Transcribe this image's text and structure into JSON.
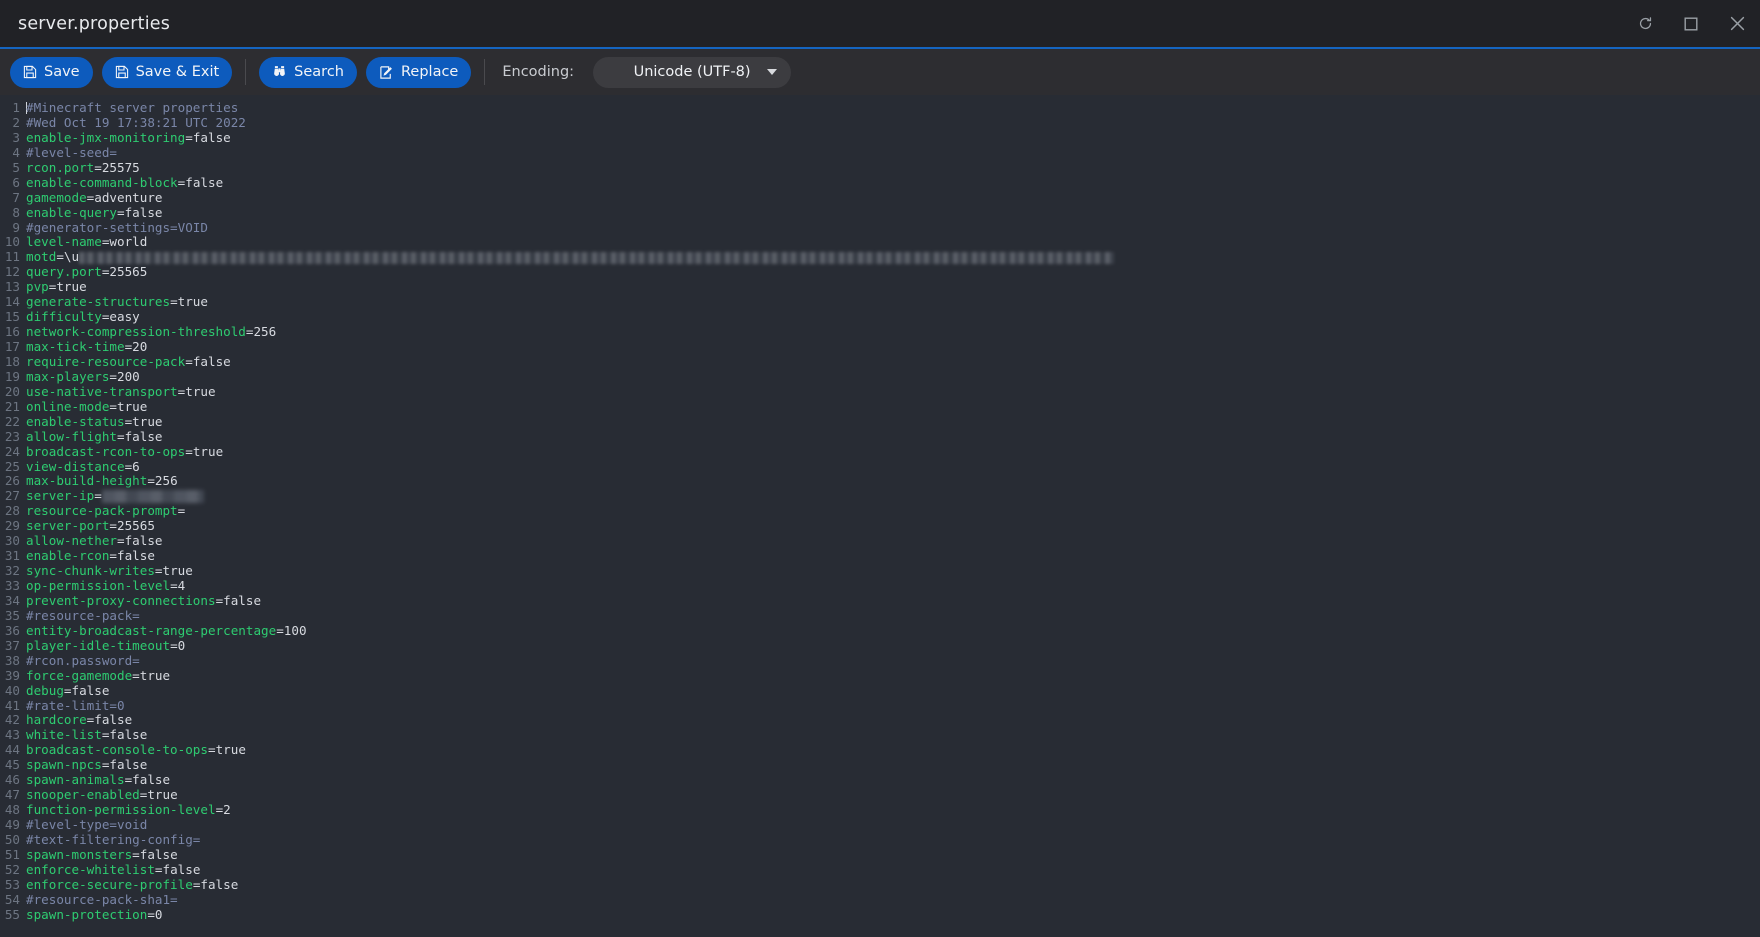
{
  "window": {
    "title": "server.properties",
    "controls": [
      {
        "name": "reload-icon",
        "label": "Reload"
      },
      {
        "name": "maximize-icon",
        "label": "Maximize"
      },
      {
        "name": "close-icon",
        "label": "Close"
      }
    ]
  },
  "toolbar": {
    "save_label": "Save",
    "save_exit_label": "Save & Exit",
    "search_label": "Search",
    "replace_label": "Replace",
    "encoding_label": "Encoding:",
    "encoding_value": "Unicode (UTF-8)",
    "accent_color": "#0d5bbd",
    "bar_color": "#2d2d31"
  },
  "editor": {
    "background": "#282c34",
    "key_color": "#2ecc71",
    "value_color": "#d7dae0",
    "comment_color": "#7a86a8",
    "gutter_color": "#6d7582",
    "caret_line": 1,
    "lines": [
      {
        "n": 1,
        "type": "comment",
        "text": "#Minecraft server properties",
        "caret": true
      },
      {
        "n": 2,
        "type": "comment",
        "text": "#Wed Oct 19 17:38:21 UTC 2022"
      },
      {
        "n": 3,
        "type": "prop",
        "key": "enable-jmx-monitoring",
        "value": "false"
      },
      {
        "n": 4,
        "type": "comment",
        "text": "#level-seed="
      },
      {
        "n": 5,
        "type": "prop",
        "key": "rcon.port",
        "value": "25575"
      },
      {
        "n": 6,
        "type": "prop",
        "key": "enable-command-block",
        "value": "false"
      },
      {
        "n": 7,
        "type": "prop",
        "key": "gamemode",
        "value": "adventure"
      },
      {
        "n": 8,
        "type": "prop",
        "key": "enable-query",
        "value": "false"
      },
      {
        "n": 9,
        "type": "comment",
        "text": "#generator-settings=VOID"
      },
      {
        "n": 10,
        "type": "prop",
        "key": "level-name",
        "value": "world"
      },
      {
        "n": 11,
        "type": "prop",
        "key": "motd",
        "value": "\\u",
        "redacted": true,
        "redact_width": 1035
      },
      {
        "n": 12,
        "type": "prop",
        "key": "query.port",
        "value": "25565"
      },
      {
        "n": 13,
        "type": "prop",
        "key": "pvp",
        "value": "true"
      },
      {
        "n": 14,
        "type": "prop",
        "key": "generate-structures",
        "value": "true"
      },
      {
        "n": 15,
        "type": "prop",
        "key": "difficulty",
        "value": "easy"
      },
      {
        "n": 16,
        "type": "prop",
        "key": "network-compression-threshold",
        "value": "256"
      },
      {
        "n": 17,
        "type": "prop",
        "key": "max-tick-time",
        "value": "20"
      },
      {
        "n": 18,
        "type": "prop",
        "key": "require-resource-pack",
        "value": "false"
      },
      {
        "n": 19,
        "type": "prop",
        "key": "max-players",
        "value": "200"
      },
      {
        "n": 20,
        "type": "prop",
        "key": "use-native-transport",
        "value": "true"
      },
      {
        "n": 21,
        "type": "prop",
        "key": "online-mode",
        "value": "true"
      },
      {
        "n": 22,
        "type": "prop",
        "key": "enable-status",
        "value": "true"
      },
      {
        "n": 23,
        "type": "prop",
        "key": "allow-flight",
        "value": "false"
      },
      {
        "n": 24,
        "type": "prop",
        "key": "broadcast-rcon-to-ops",
        "value": "true"
      },
      {
        "n": 25,
        "type": "prop",
        "key": "view-distance",
        "value": "6"
      },
      {
        "n": 26,
        "type": "prop",
        "key": "max-build-height",
        "value": "256"
      },
      {
        "n": 27,
        "type": "prop",
        "key": "server-ip",
        "value": "",
        "redacted_ip": true,
        "redact_width": 102
      },
      {
        "n": 28,
        "type": "prop",
        "key": "resource-pack-prompt",
        "value": ""
      },
      {
        "n": 29,
        "type": "prop",
        "key": "server-port",
        "value": "25565"
      },
      {
        "n": 30,
        "type": "prop",
        "key": "allow-nether",
        "value": "false"
      },
      {
        "n": 31,
        "type": "prop",
        "key": "enable-rcon",
        "value": "false"
      },
      {
        "n": 32,
        "type": "prop",
        "key": "sync-chunk-writes",
        "value": "true"
      },
      {
        "n": 33,
        "type": "prop",
        "key": "op-permission-level",
        "value": "4"
      },
      {
        "n": 34,
        "type": "prop",
        "key": "prevent-proxy-connections",
        "value": "false"
      },
      {
        "n": 35,
        "type": "comment",
        "text": "#resource-pack="
      },
      {
        "n": 36,
        "type": "prop",
        "key": "entity-broadcast-range-percentage",
        "value": "100"
      },
      {
        "n": 37,
        "type": "prop",
        "key": "player-idle-timeout",
        "value": "0"
      },
      {
        "n": 38,
        "type": "comment",
        "text": "#rcon.password="
      },
      {
        "n": 39,
        "type": "prop",
        "key": "force-gamemode",
        "value": "true"
      },
      {
        "n": 40,
        "type": "prop",
        "key": "debug",
        "value": "false"
      },
      {
        "n": 41,
        "type": "comment",
        "text": "#rate-limit=0"
      },
      {
        "n": 42,
        "type": "prop",
        "key": "hardcore",
        "value": "false"
      },
      {
        "n": 43,
        "type": "prop",
        "key": "white-list",
        "value": "false"
      },
      {
        "n": 44,
        "type": "prop",
        "key": "broadcast-console-to-ops",
        "value": "true"
      },
      {
        "n": 45,
        "type": "prop",
        "key": "spawn-npcs",
        "value": "false"
      },
      {
        "n": 46,
        "type": "prop",
        "key": "spawn-animals",
        "value": "false"
      },
      {
        "n": 47,
        "type": "prop",
        "key": "snooper-enabled",
        "value": "true"
      },
      {
        "n": 48,
        "type": "prop",
        "key": "function-permission-level",
        "value": "2"
      },
      {
        "n": 49,
        "type": "comment",
        "text": "#level-type=void"
      },
      {
        "n": 50,
        "type": "comment",
        "text": "#text-filtering-config="
      },
      {
        "n": 51,
        "type": "prop",
        "key": "spawn-monsters",
        "value": "false"
      },
      {
        "n": 52,
        "type": "prop",
        "key": "enforce-whitelist",
        "value": "false"
      },
      {
        "n": 53,
        "type": "prop",
        "key": "enforce-secure-profile",
        "value": "false"
      },
      {
        "n": 54,
        "type": "comment",
        "text": "#resource-pack-sha1="
      },
      {
        "n": 55,
        "type": "prop",
        "key": "spawn-protection",
        "value": "0"
      }
    ]
  }
}
